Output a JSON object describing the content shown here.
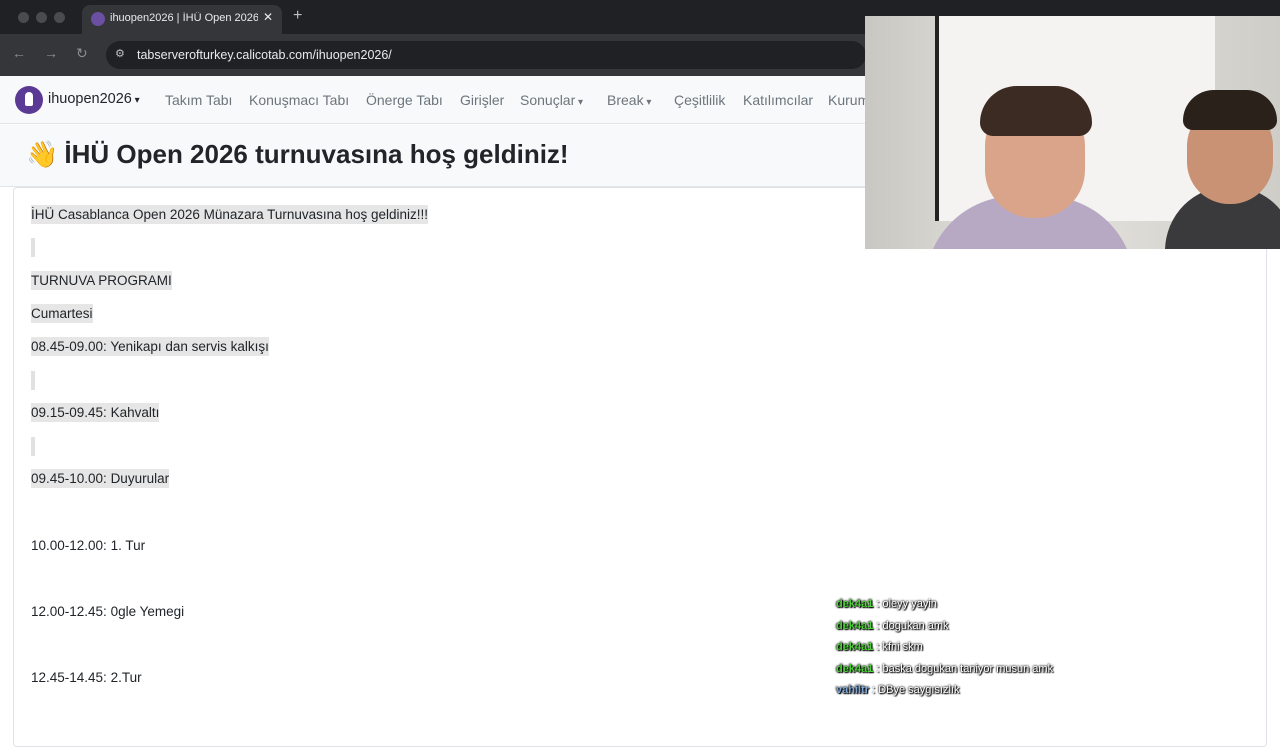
{
  "browser": {
    "tab_title": "ihuopen2026 | İHÜ Open 2026",
    "tab_close": "✕",
    "new_tab": "+",
    "back": "←",
    "forward": "→",
    "reload": "↻",
    "site_info_icon": "⚙",
    "url": "tabserverofturkey.calicotab.com/ihuopen2026/"
  },
  "navbar": {
    "brand": "ihuopen2026",
    "links": [
      {
        "label": "Takım Tabı"
      },
      {
        "label": "Konuşmacı Tabı"
      },
      {
        "label": "Önerge Tabı"
      },
      {
        "label": "Girişler"
      },
      {
        "label": "Sonuçlar"
      },
      {
        "label": "Break"
      },
      {
        "label": "Çeşitlilik"
      },
      {
        "label": "Katılımcılar"
      },
      {
        "label": "Kurum"
      }
    ]
  },
  "page": {
    "wave": "👋",
    "title": "İHÜ Open 2026 turnuvasına hoş geldiniz!"
  },
  "content": {
    "lines": [
      "İHÜ Casablanca Open 2026 Münazara Turnuvasına hoş geldiniz!!!",
      "TURNUVA PROGRAMI",
      "Cumartesi",
      "08.45-09.00: Yenikapı dan servis kalkışı",
      "09.15-09.45: Kahvaltı",
      "09.45-10.00: Duyurular",
      "10.00-12.00: 1. Tur",
      "12.00-12.45: 0gle Yemegi",
      "12.45-14.45: 2.Tur"
    ]
  },
  "chat": {
    "messages": [
      {
        "user": "dek4a1",
        "text": ": oleyy yayin",
        "color": "#4cd137"
      },
      {
        "user": "dek4a1",
        "text": ": dogukan amk",
        "color": "#4cd137"
      },
      {
        "user": "dek4a1",
        "text": ": kfni skm",
        "color": "#4cd137"
      },
      {
        "user": "dek4a1",
        "text": ": baska dogukan taniyor musun amk",
        "color": "#4cd137"
      },
      {
        "user": "vahiltr",
        "text": ": DBye saygısızlık",
        "color": "#7fa7d6"
      }
    ]
  }
}
